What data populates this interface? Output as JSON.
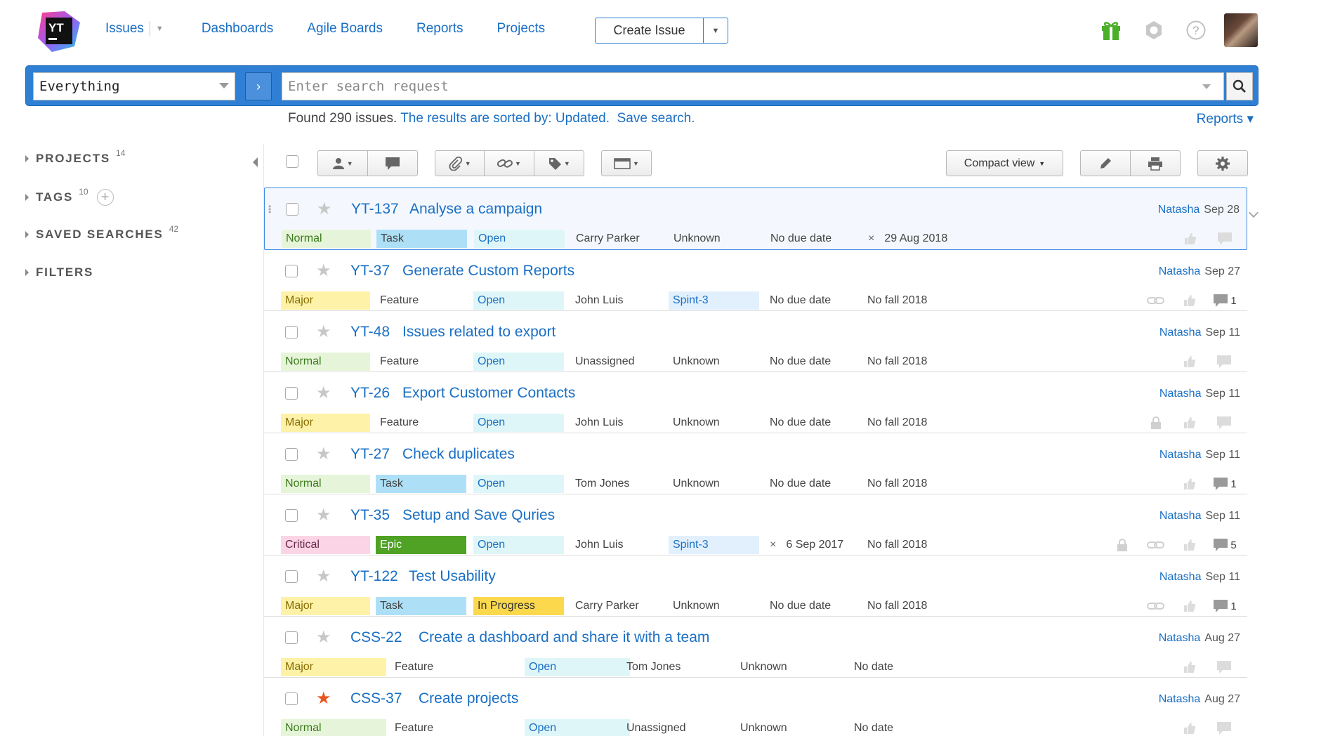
{
  "header": {
    "nav": [
      "Issues",
      "Dashboards",
      "Agile Boards",
      "Reports",
      "Projects"
    ],
    "create_issue": "Create Issue",
    "logo_text": "YT"
  },
  "search": {
    "context": "Everything",
    "placeholder": "Enter search request"
  },
  "results": {
    "found": "Found 290 issues.",
    "sorted": "The results are sorted by: Updated.",
    "save": "Save search.",
    "reports": "Reports ▾"
  },
  "sidebar": {
    "items": [
      {
        "label": "PROJECTS",
        "count": "14"
      },
      {
        "label": "TAGS",
        "count": "10"
      },
      {
        "label": "SAVED SEARCHES",
        "count": "42"
      },
      {
        "label": "FILTERS",
        "count": ""
      }
    ]
  },
  "toolbar": {
    "compact_view": "Compact view"
  },
  "colors": {
    "Normal": "#e6f5d9",
    "Major": "#fdf2a8",
    "Critical": "#fbd4e6",
    "Task": "#ade0f6",
    "Feature": "transparent",
    "Epic": "#4fa224",
    "Open": "#dff6f8",
    "In Progress": "#fcd84c",
    "Sprint": "#e2f0fd"
  },
  "issues": [
    {
      "id": "YT-137",
      "summary": "Analyse a campaign",
      "user": "Natasha",
      "date": "Sep 28",
      "priority": "Normal",
      "type": "Task",
      "state": "Open",
      "assignee": "Carry Parker",
      "sprint": "Unknown",
      "due": "No due date",
      "fix": "29 Aug 2018",
      "fix_x": true,
      "starred": false,
      "selected": true,
      "lock": false,
      "link": false,
      "comments": ""
    },
    {
      "id": "YT-37",
      "summary": "Generate Custom Reports",
      "user": "Natasha",
      "date": "Sep 27",
      "priority": "Major",
      "type": "Feature",
      "state": "Open",
      "assignee": "John Luis",
      "sprint": "Spint-3",
      "due": "No due date",
      "fix": "No fall 2018",
      "fix_x": false,
      "starred": false,
      "selected": false,
      "lock": false,
      "link": true,
      "comments": "1"
    },
    {
      "id": "YT-48",
      "summary": "Issues related to export",
      "user": "Natasha",
      "date": "Sep 11",
      "priority": "Normal",
      "type": "Feature",
      "state": "Open",
      "assignee": "Unassigned",
      "sprint": "Unknown",
      "due": "No due date",
      "fix": "No fall 2018",
      "fix_x": false,
      "starred": false,
      "selected": false,
      "lock": false,
      "link": false,
      "comments": ""
    },
    {
      "id": "YT-26",
      "summary": "Export Customer Contacts",
      "user": "Natasha",
      "date": "Sep 11",
      "priority": "Major",
      "type": "Feature",
      "state": "Open",
      "assignee": "John Luis",
      "sprint": "Unknown",
      "due": "No due date",
      "fix": "No fall 2018",
      "fix_x": false,
      "starred": false,
      "selected": false,
      "lock": true,
      "link": false,
      "comments": ""
    },
    {
      "id": "YT-27",
      "summary": "Check duplicates",
      "user": "Natasha",
      "date": "Sep 11",
      "priority": "Normal",
      "type": "Task",
      "state": "Open",
      "assignee": "Tom Jones",
      "sprint": "Unknown",
      "due": "No due date",
      "fix": "No fall 2018",
      "fix_x": false,
      "starred": false,
      "selected": false,
      "lock": false,
      "link": false,
      "comments": "1"
    },
    {
      "id": "YT-35",
      "summary": "Setup and Save Quries",
      "user": "Natasha",
      "date": "Sep 11",
      "priority": "Critical",
      "type": "Epic",
      "state": "Open",
      "assignee": "John Luis",
      "sprint": "Spint-3",
      "due": "6 Sep 2017",
      "due_x": true,
      "fix": "No fall 2018",
      "fix_x": false,
      "starred": false,
      "selected": false,
      "lock": true,
      "link": true,
      "comments": "5"
    },
    {
      "id": "YT-122",
      "summary": "Test Usability",
      "user": "Natasha",
      "date": "Sep 11",
      "priority": "Major",
      "type": "Task",
      "state": "In Progress",
      "assignee": "Carry Parker",
      "sprint": "Unknown",
      "due": "No due date",
      "fix": "No fall 2018",
      "fix_x": false,
      "starred": false,
      "selected": false,
      "lock": false,
      "link": true,
      "comments": "1"
    },
    {
      "id": "CSS-22",
      "summary": "Create a dashboard and share it with a team",
      "user": "Natasha",
      "date": "Aug 27",
      "priority": "Major",
      "type": "Feature",
      "state": "Open",
      "assignee": "Tom Jones",
      "sprint": "Unknown",
      "due": "No date",
      "fix": "",
      "fix_x": false,
      "starred": false,
      "selected": false,
      "lock": false,
      "link": false,
      "comments": "",
      "wide": true
    },
    {
      "id": "CSS-37",
      "summary": "Create projects",
      "user": "Natasha",
      "date": "Aug 27",
      "priority": "Normal",
      "type": "Feature",
      "state": "Open",
      "assignee": "Unassigned",
      "sprint": "Unknown",
      "due": "No date",
      "fix": "",
      "fix_x": false,
      "starred": true,
      "selected": false,
      "lock": false,
      "link": false,
      "comments": "",
      "wide": true
    }
  ]
}
